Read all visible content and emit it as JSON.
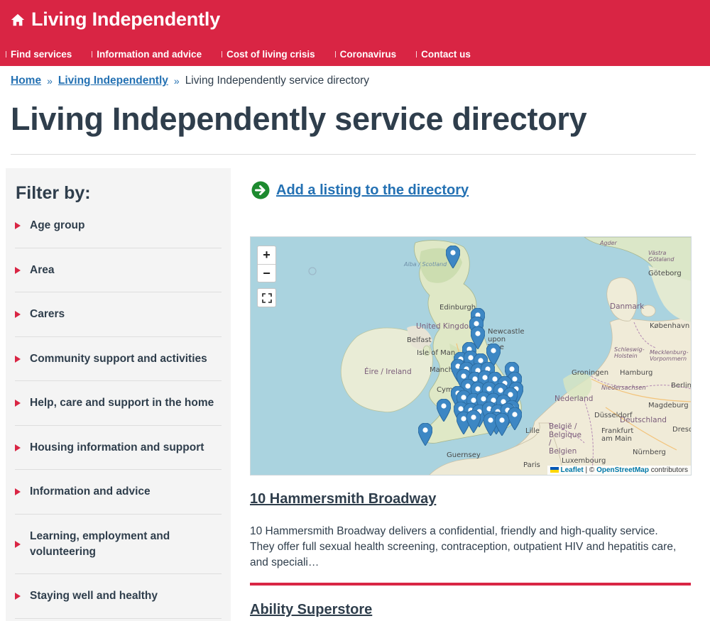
{
  "header": {
    "logo_icon": "home-icon",
    "title": "Living Independently",
    "brand_color": "#d92544",
    "nav": [
      {
        "label": "Find services"
      },
      {
        "label": "Information and advice"
      },
      {
        "label": "Cost of living crisis"
      },
      {
        "label": "Coronavirus"
      },
      {
        "label": "Contact us"
      }
    ]
  },
  "breadcrumb": {
    "home": "Home",
    "section": "Living Independently",
    "separator": "»",
    "current": "Living Independently service directory"
  },
  "page": {
    "title": "Living Independently service directory"
  },
  "sidebar": {
    "heading": "Filter by:",
    "filters": [
      {
        "label": "Age group"
      },
      {
        "label": "Area"
      },
      {
        "label": "Carers"
      },
      {
        "label": "Community support and activities"
      },
      {
        "label": "Help, care and support in the home"
      },
      {
        "label": "Housing information and support"
      },
      {
        "label": "Information and advice"
      },
      {
        "label": "Learning, employment and volunteering"
      },
      {
        "label": "Staying well and healthy"
      }
    ]
  },
  "main": {
    "add_listing": {
      "icon": "arrow-right-circle-icon",
      "label": "Add a listing to the directory"
    },
    "map": {
      "zoom_in": "+",
      "zoom_out": "−",
      "fullscreen_icon": "fullscreen-icon",
      "labels": {
        "sea_1": "Alba / Scotland",
        "edinburgh": "Edinburgh",
        "uk": "United Kingdom",
        "newcastle": "Newcastle upon Tyne",
        "belfast": "Belfast",
        "isle_of_man": "Isle of Man",
        "eire": "Éire / Ireland",
        "manchester": "Manchester",
        "cymru": "Cymru",
        "guernsey": "Guernsey",
        "paris": "Paris",
        "lille": "Lille",
        "belgie": "België / Belgique / Belgien",
        "luxembourg": "Luxembourg",
        "nederland": "Nederland",
        "groningen": "Groningen",
        "hamburg": "Hamburg",
        "niedersachsen": "Niedersachsen",
        "berlin": "Berlin",
        "magdeburg": "Magdeburg",
        "dusseldorf": "Düsseldorf",
        "deutschland": "Deutschland",
        "frankfurt": "Frankfurt am Main",
        "nurnberg": "Nürnberg",
        "dresden": "Dresd",
        "danmark": "Danmark",
        "kobenhavn": "København",
        "schleswig": "Schleswig-Holstein",
        "mecklenburg": "Mecklenburg-Vorpommern",
        "agder": "Agder",
        "vastra": "Västra Götaland",
        "goteborg": "Göteborg"
      },
      "attribution": {
        "leaflet": "Leaflet",
        "separator": " | © ",
        "osm": "OpenStreetMap",
        "contributors": " contributors"
      },
      "marker_color": "#3d87c4"
    },
    "listings": [
      {
        "title": "10 Hammersmith Broadway",
        "description": "10 Hammersmith Broadway delivers a confidential, friendly and high-quality service. They offer full sexual health screening, contraception, outpatient HIV and hepatitis care, and speciali…"
      },
      {
        "title": "Ability Superstore"
      }
    ]
  }
}
